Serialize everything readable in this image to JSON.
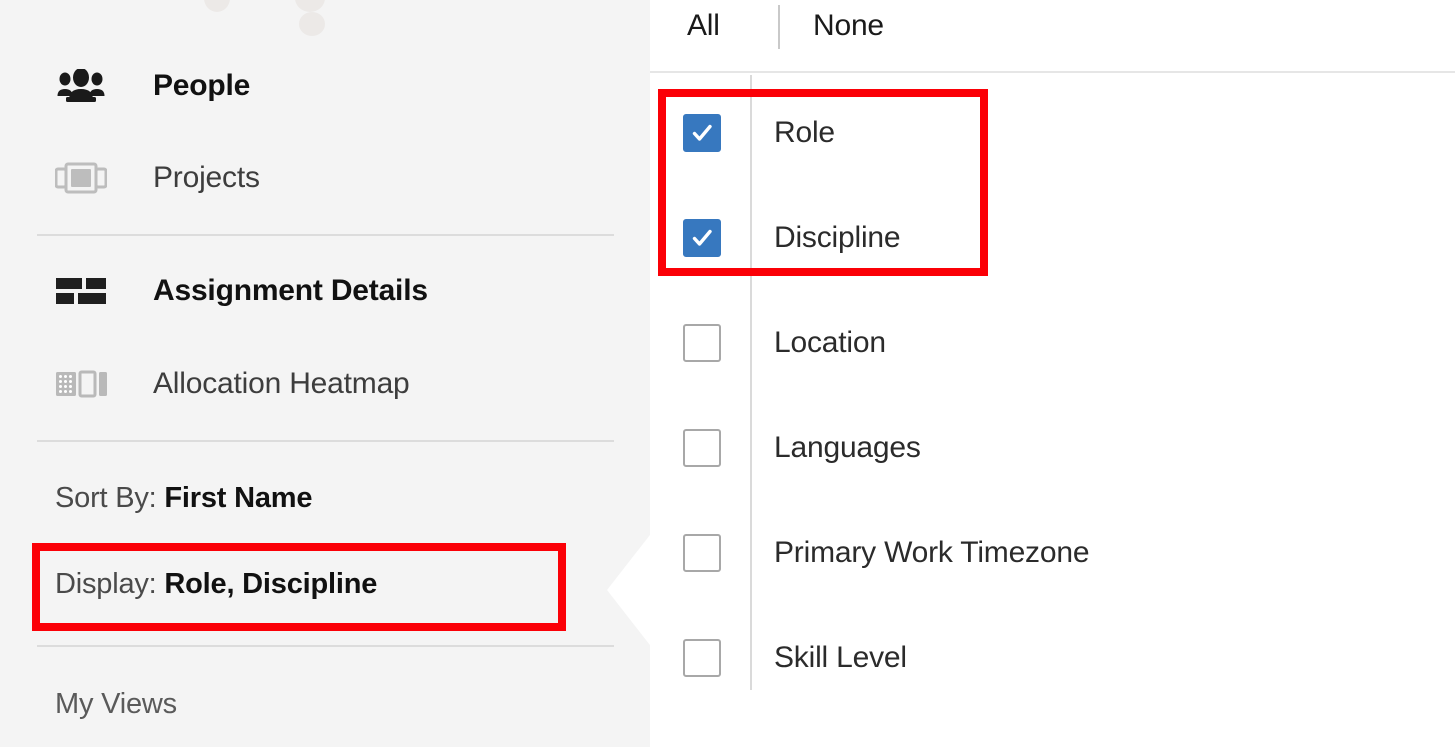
{
  "sidebar": {
    "nav": [
      {
        "label": "People",
        "icon": "people-group-icon",
        "bold": true,
        "active": true
      },
      {
        "label": "Projects",
        "icon": "projects-carousel-icon",
        "bold": false,
        "active": false
      },
      {
        "label": "Assignment Details",
        "icon": "assignment-bars-icon",
        "bold": true,
        "active": true
      },
      {
        "label": "Allocation Heatmap",
        "icon": "allocation-heatmap-icon",
        "bold": false,
        "active": false
      }
    ],
    "sort_by_label": "Sort By:",
    "sort_by_value": "First Name",
    "display_label": "Display:",
    "display_value": "Role, Discipline",
    "my_views": "My Views"
  },
  "panel": {
    "header": {
      "all_label": "All",
      "none_label": "None"
    },
    "options": [
      {
        "label": "Role",
        "checked": true
      },
      {
        "label": "Discipline",
        "checked": true
      },
      {
        "label": "Location",
        "checked": false
      },
      {
        "label": "Languages",
        "checked": false
      },
      {
        "label": "Primary Work Timezone",
        "checked": false
      },
      {
        "label": "Skill Level",
        "checked": false
      }
    ]
  },
  "colors": {
    "highlight": "#fb0007",
    "checkbox_checked": "#3778bf",
    "sidebar_bg": "#f4f4f4",
    "panel_bg": "#ffffff",
    "divider": "#dcdcdc"
  }
}
